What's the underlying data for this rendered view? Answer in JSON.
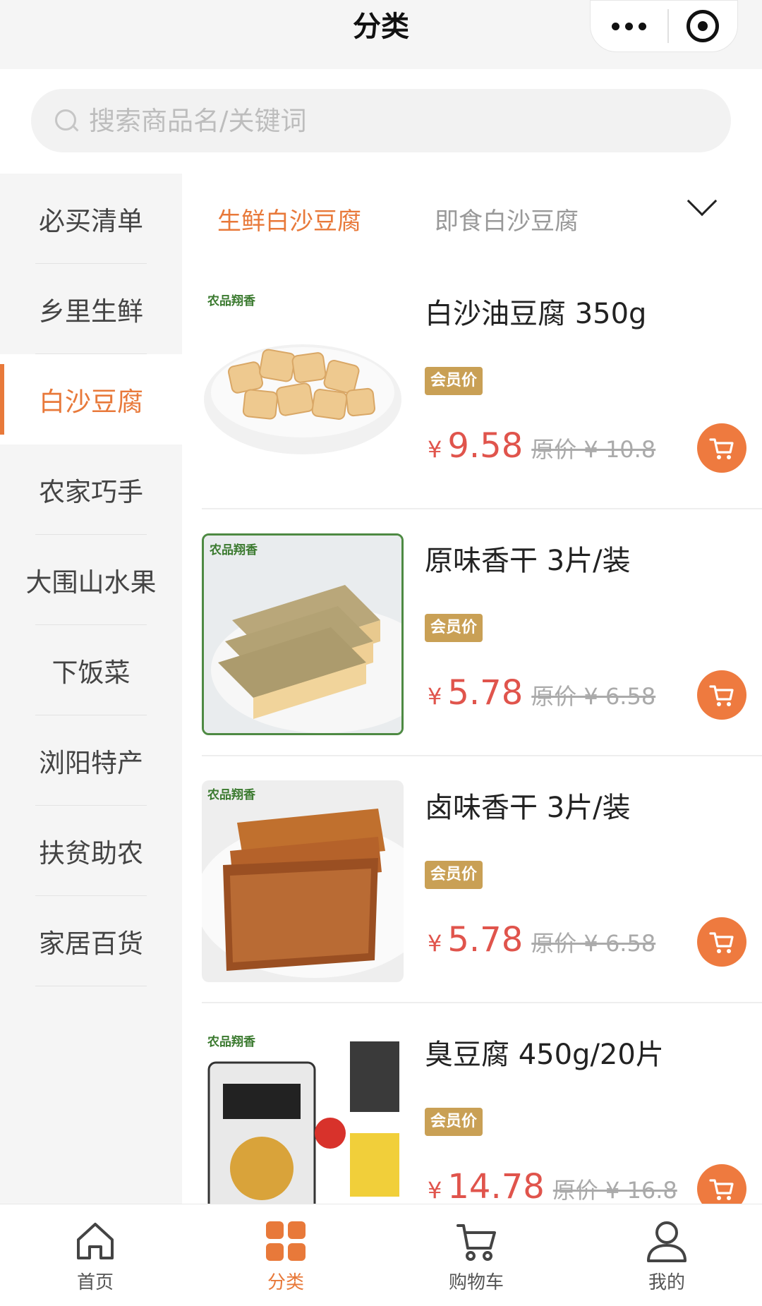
{
  "header": {
    "title": "分类"
  },
  "search": {
    "placeholder": "搜索商品名/关键词"
  },
  "sidebar": {
    "items": [
      {
        "label": "必买清单"
      },
      {
        "label": "乡里生鲜"
      },
      {
        "label": "白沙豆腐",
        "active": true
      },
      {
        "label": "农家巧手"
      },
      {
        "label": "大围山水果"
      },
      {
        "label": "下饭菜"
      },
      {
        "label": "浏阳特产"
      },
      {
        "label": "扶贫助农"
      },
      {
        "label": "家居百货"
      }
    ]
  },
  "subtabs": {
    "active": "生鲜白沙豆腐",
    "other": "即食白沙豆腐"
  },
  "products": [
    {
      "brand": "农品翔香",
      "name": "白沙油豆腐 350g",
      "badge": "会员价",
      "yen": "¥",
      "price": "9.58",
      "original": "原价 ¥ 10.8"
    },
    {
      "brand": "农品翔香",
      "name": "原味香干 3片/装",
      "badge": "会员价",
      "yen": "¥",
      "price": "5.78",
      "original": "原价 ¥ 6.58"
    },
    {
      "brand": "农品翔香",
      "name": "卤味香干 3片/装",
      "badge": "会员价",
      "yen": "¥",
      "price": "5.78",
      "original": "原价 ¥ 6.58"
    },
    {
      "brand": "农品翔香",
      "name": "臭豆腐 450g/20片",
      "badge": "会员价",
      "yen": "¥",
      "price": "14.78",
      "original": "原价 ¥ 16.8"
    }
  ],
  "tabbar": {
    "home": "首页",
    "category": "分类",
    "cart": "购物车",
    "mine": "我的"
  },
  "colors": {
    "accent": "#e8793a",
    "price": "#e0544c",
    "badge": "#c9a055",
    "cart": "#ee7a3f"
  }
}
